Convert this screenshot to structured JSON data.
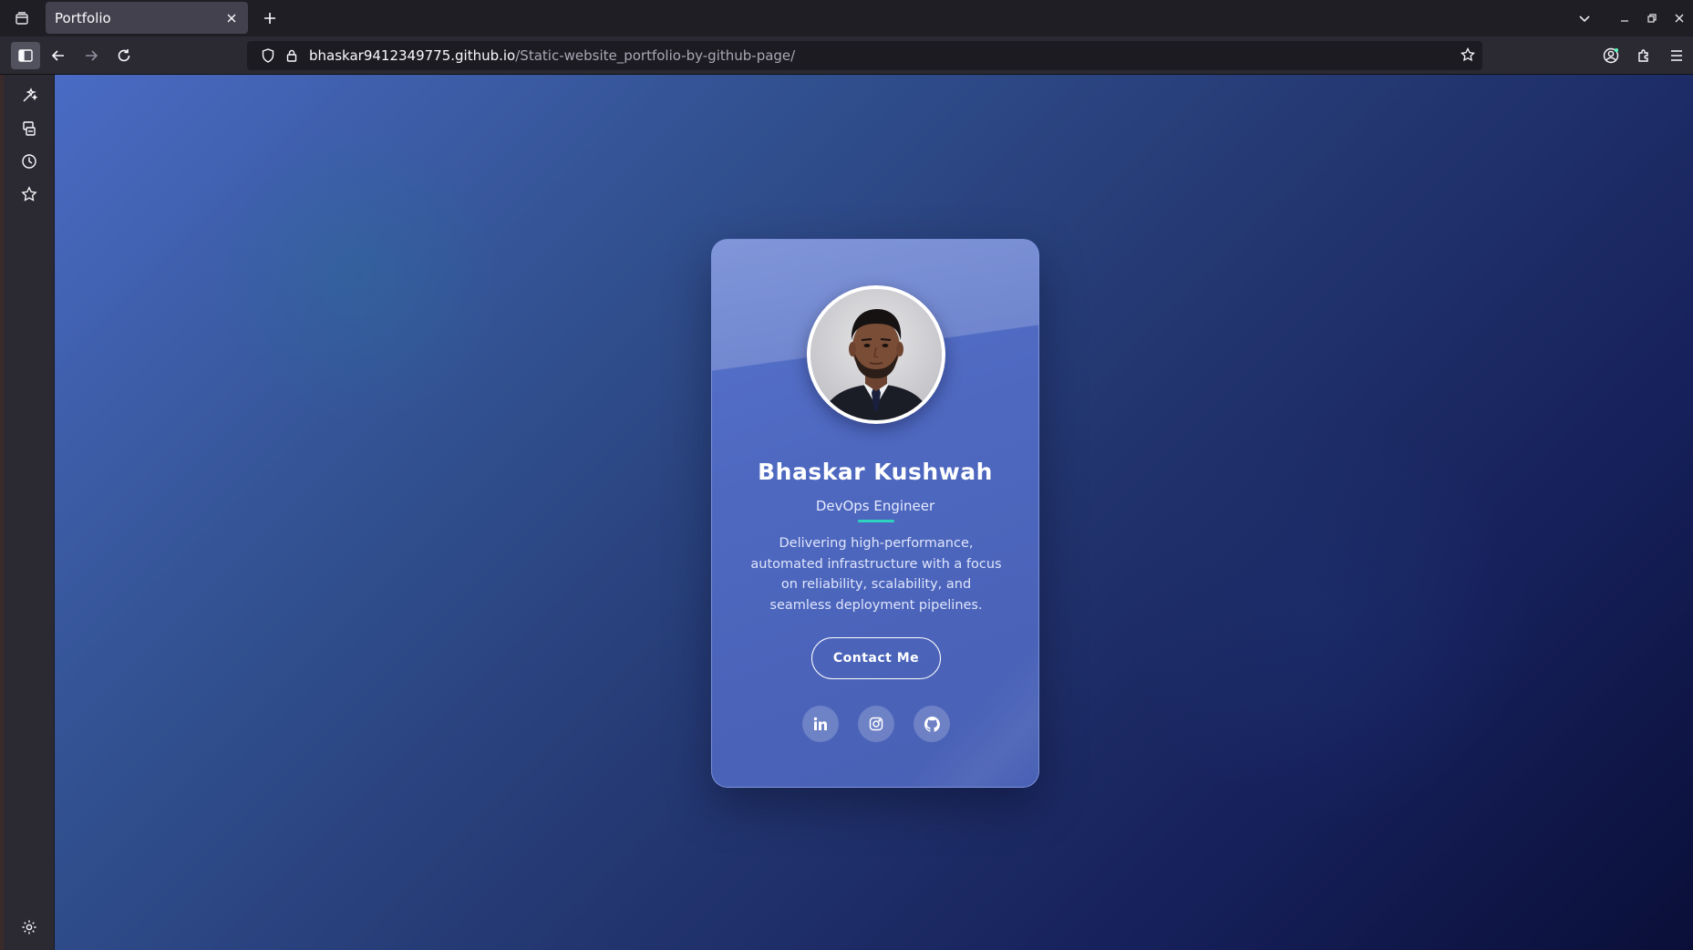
{
  "browser": {
    "tab": {
      "title": "Portfolio"
    },
    "url": {
      "host": "bhaskar9412349775.github.io",
      "path": "/Static-website_portfolio-by-github-page/"
    }
  },
  "profile": {
    "name": "Bhaskar Kushwah",
    "role": "DevOps Engineer",
    "bio": "Delivering high-performance, automated infrastructure with a focus on reliability, scalability, and seamless deployment pipelines.",
    "contact_label": "Contact Me",
    "socials": [
      {
        "icon": "linkedin-icon"
      },
      {
        "icon": "instagram-icon"
      },
      {
        "icon": "github-icon"
      }
    ]
  },
  "colors": {
    "accent": "#2dd4bf",
    "card": "#4e68c0",
    "background_start": "#4a6bc4",
    "background_end": "#0a0f38"
  }
}
